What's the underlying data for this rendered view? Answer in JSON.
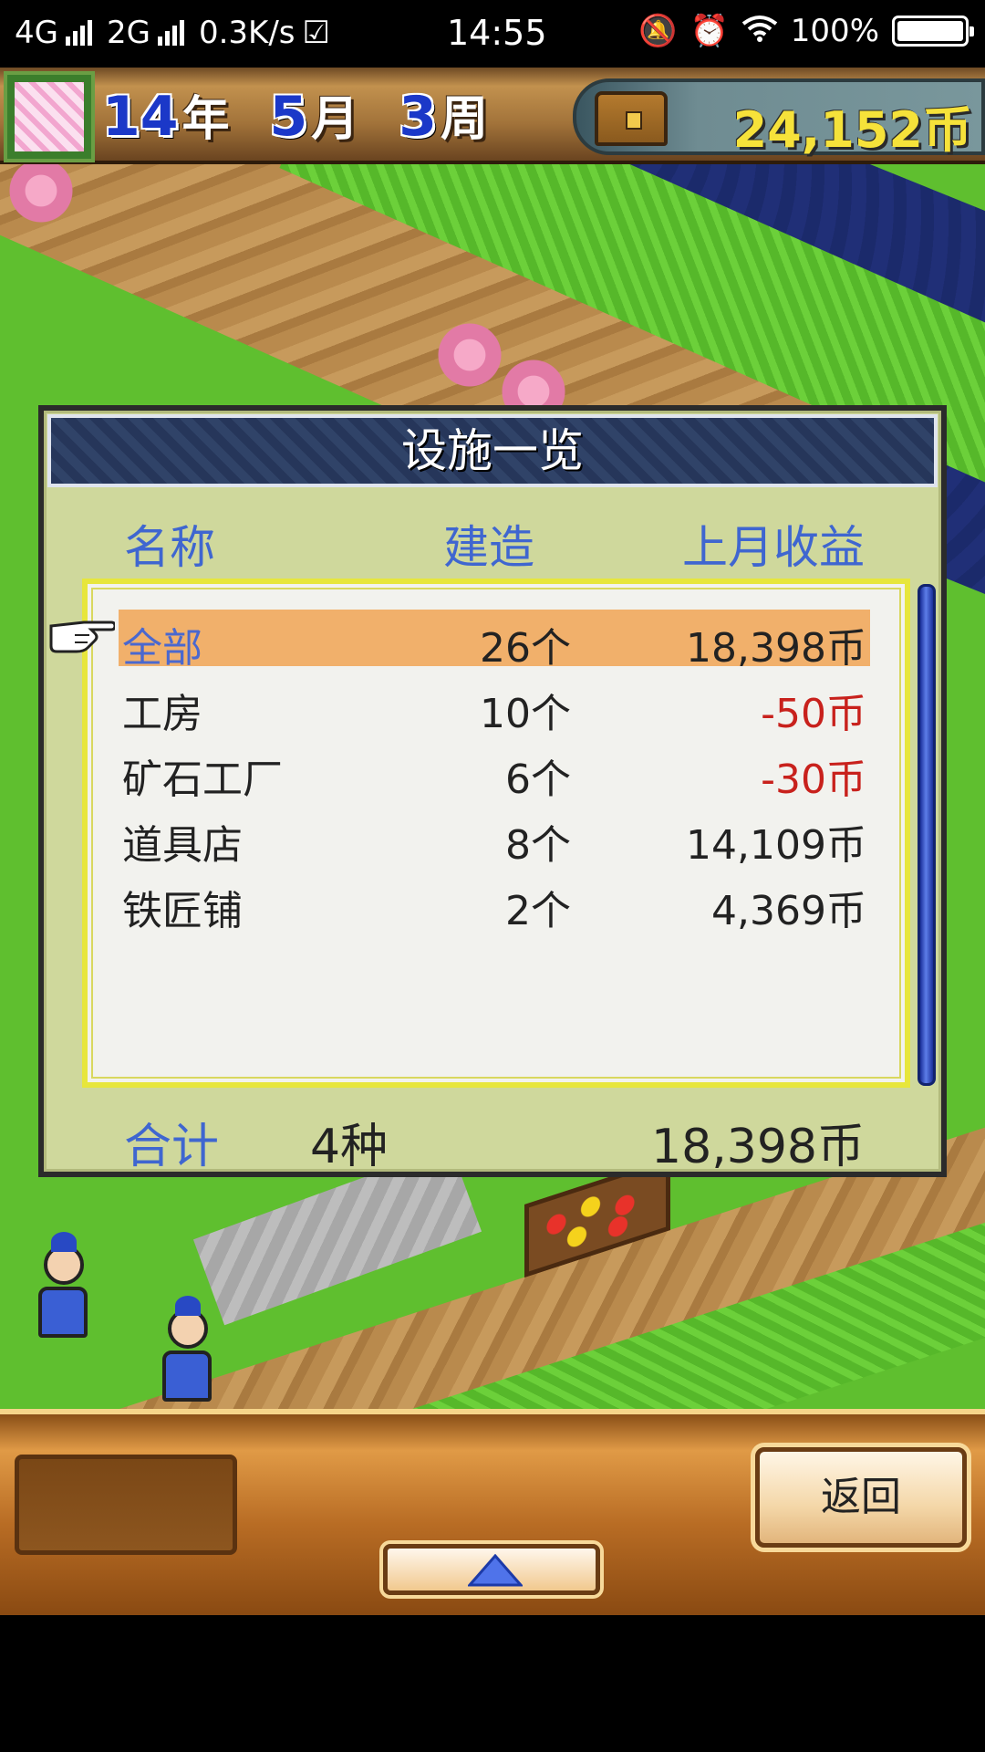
{
  "status_bar": {
    "network1": "4G",
    "network2": "2G",
    "speed": "0.3K/s",
    "time": "14:55",
    "battery": "100%"
  },
  "hud": {
    "year_num": "14",
    "year_unit": "年",
    "month_num": "5",
    "month_unit": "月",
    "week_num": "3",
    "week_unit": "周",
    "money": "24,152币"
  },
  "dialog": {
    "title": "设施一览",
    "headers": {
      "name": "名称",
      "built": "建造",
      "revenue": "上月收益"
    },
    "rows": [
      {
        "name": "全部",
        "count": "26个",
        "revenue": "18,398币"
      },
      {
        "name": "工房",
        "count": "10个",
        "revenue": "-50币"
      },
      {
        "name": "矿石工厂",
        "count": "6个",
        "revenue": "-30币"
      },
      {
        "name": "道具店",
        "count": "8个",
        "revenue": "14,109币"
      },
      {
        "name": "铁匠铺",
        "count": "2个",
        "revenue": "4,369币"
      }
    ],
    "total": {
      "label": "合计",
      "kinds": "4种",
      "amount": "18,398币"
    }
  },
  "bottom": {
    "back_label": "返回"
  },
  "colors": {
    "header_blue": "#3f66d0",
    "negative_red": "#c8211c",
    "selected_row": "#f1b06b",
    "money_yellow": "#f6e23a"
  }
}
